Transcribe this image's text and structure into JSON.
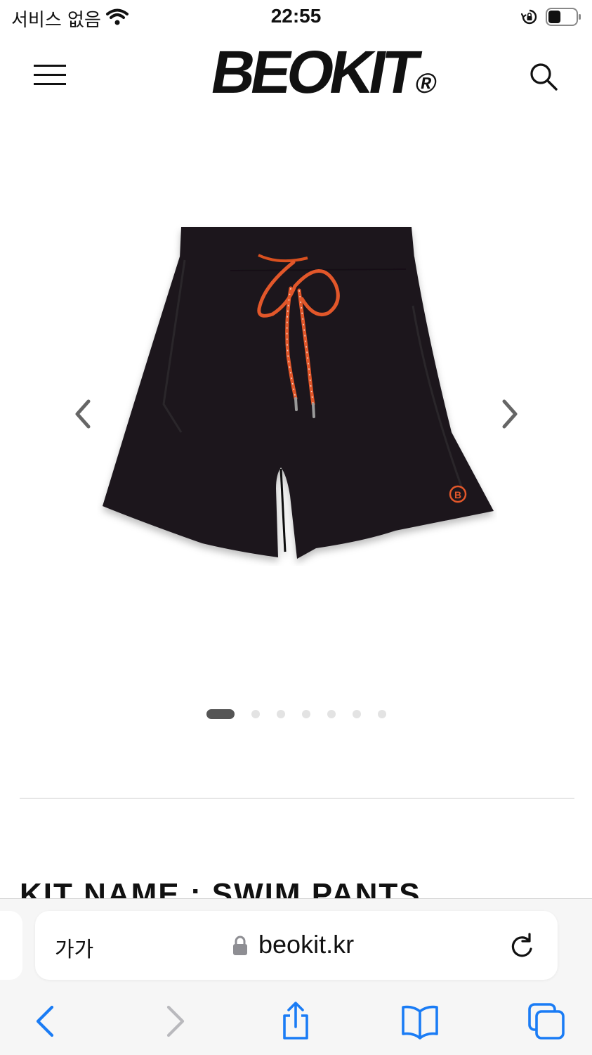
{
  "status_bar": {
    "carrier": "서비스 없음",
    "time": "22:55",
    "battery_level": 0.45
  },
  "header": {
    "logo": "BEOKIT",
    "logo_mark": "®"
  },
  "gallery": {
    "slide_count": 7,
    "active_slide": 1,
    "accent_color": "#e2572a"
  },
  "product": {
    "kit_name": "KIT NAME : SWIM PANTS"
  },
  "browser": {
    "text_size_button": "가가",
    "url": "beokit.kr",
    "tint_color": "#1a7cf5"
  }
}
